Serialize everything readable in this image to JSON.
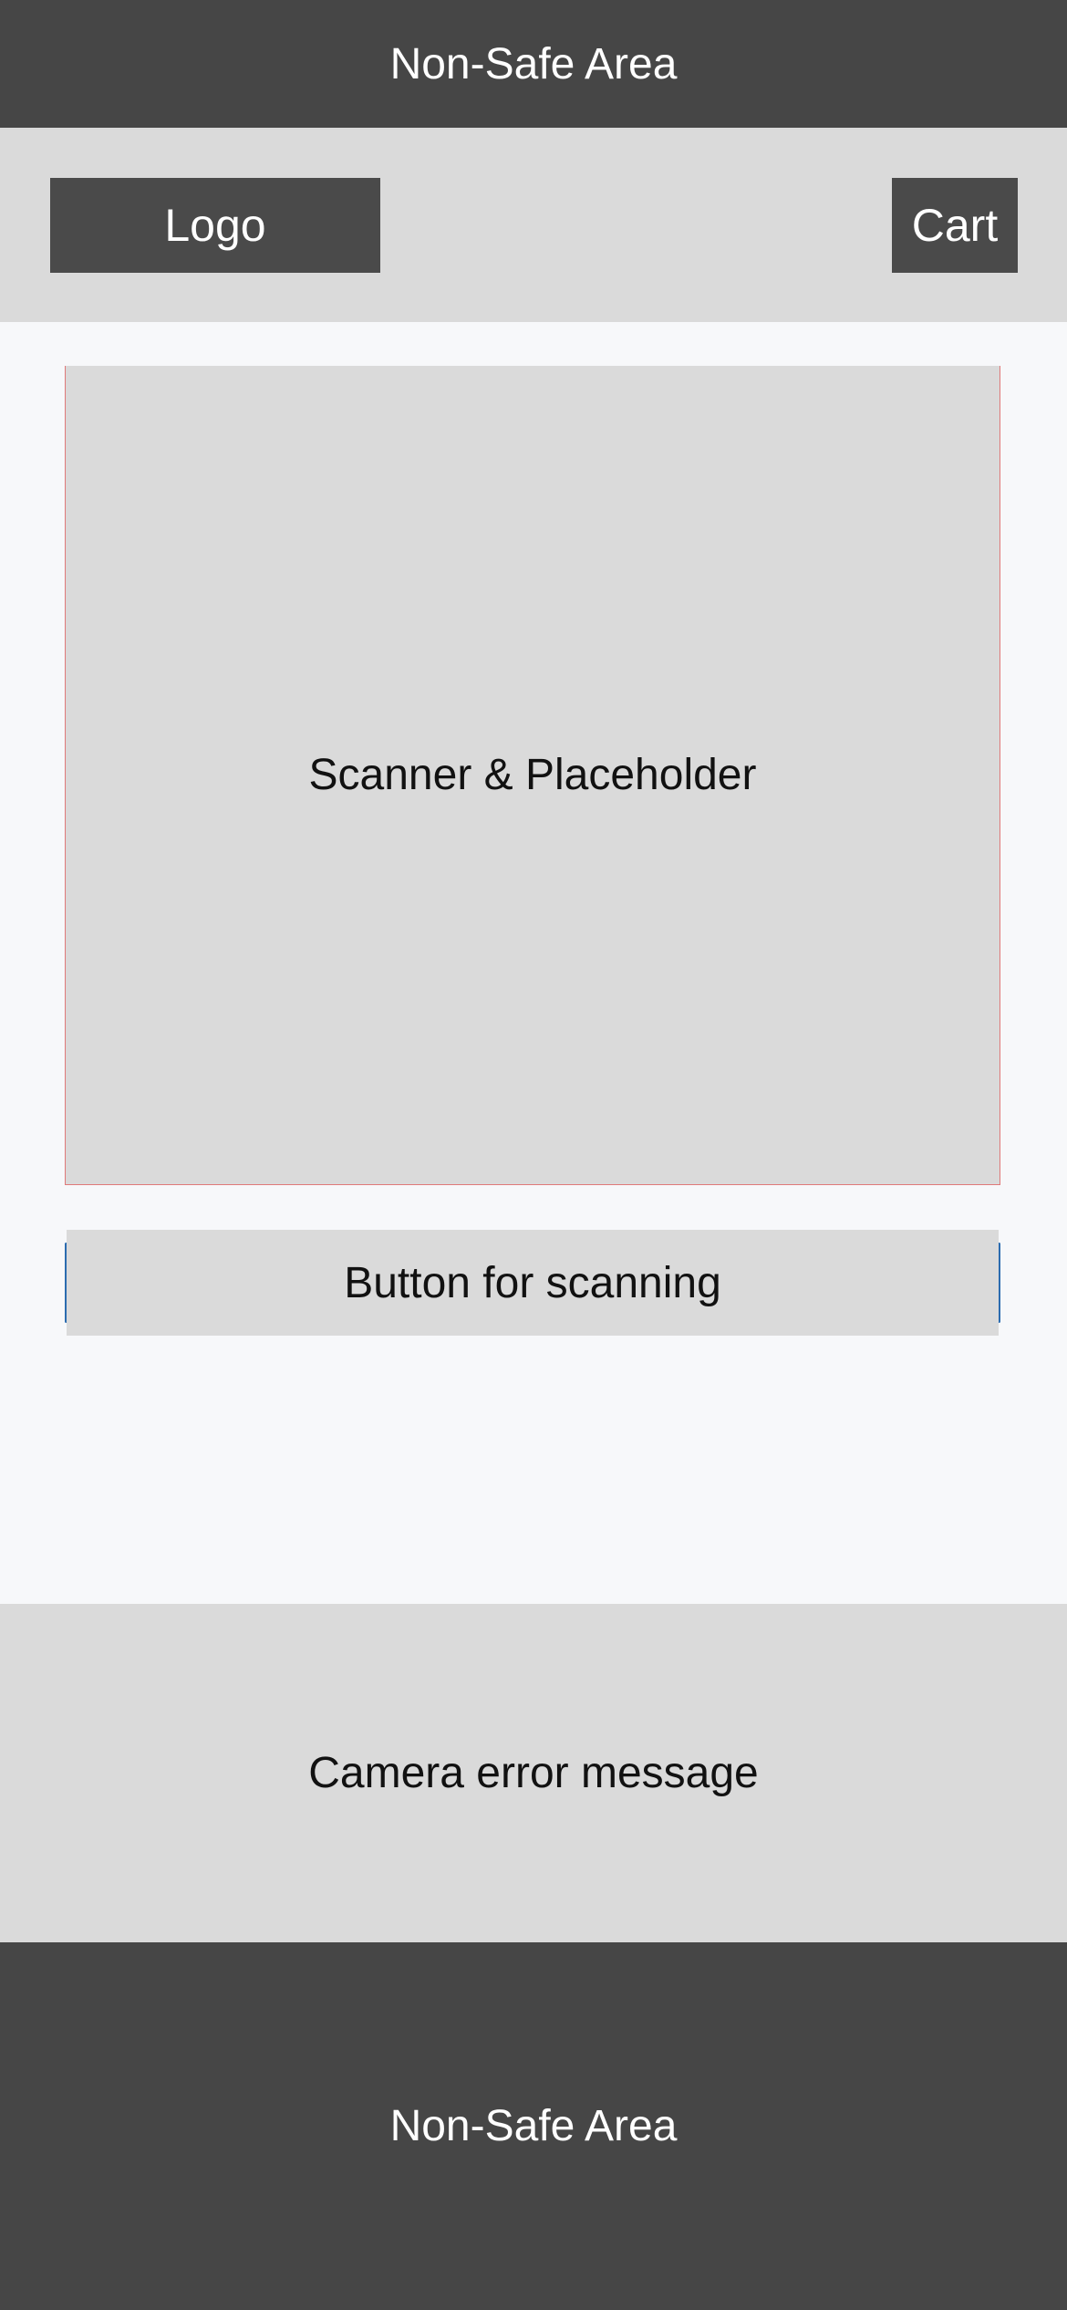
{
  "top_nonsafe": {
    "label": "Non-Safe Area"
  },
  "header": {
    "logo_label": "Logo",
    "cart_label": "Cart"
  },
  "scanner": {
    "label": "Scanner & Placeholder"
  },
  "scan_button": {
    "label": "Button for scanning"
  },
  "error": {
    "message": "Camera error message"
  },
  "bottom_nonsafe": {
    "label": "Non-Safe Area"
  },
  "colors": {
    "nonsafe_bg": "#464646",
    "panel_bg": "#dadada",
    "page_bg": "#f7f8fa",
    "scanner_outline": "#e07a7a",
    "button_edge": "#2b6cb0"
  }
}
